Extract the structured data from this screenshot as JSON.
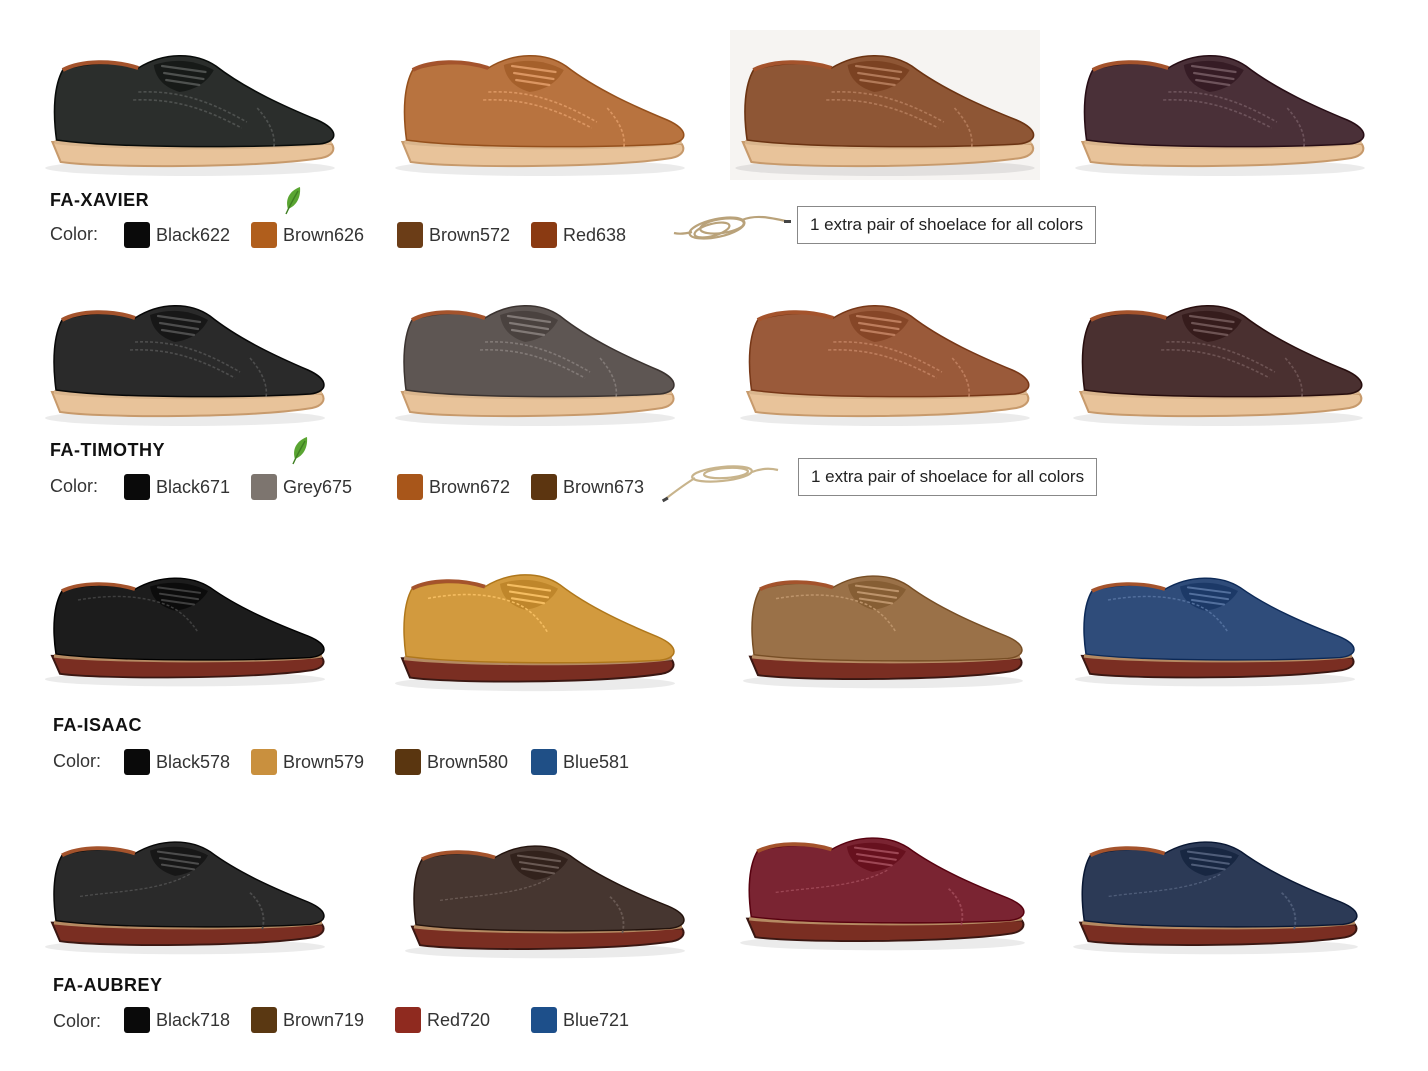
{
  "color_label": "Color:",
  "shoelace_note": "1 extra pair of shoelace for all colors",
  "products": [
    {
      "name": "FA-XAVIER",
      "eco_icon": "leaf-icon",
      "style": "wingtip",
      "colors": [
        {
          "name": "Black622",
          "hex": "#0a0a0a",
          "upper": "#2b2e2c"
        },
        {
          "name": "Brown626",
          "hex": "#b05e1c",
          "upper": "#b8733f"
        },
        {
          "name": "Brown572",
          "hex": "#6b3d17",
          "upper": "#8e5635"
        },
        {
          "name": "Red638",
          "hex": "#8a3a12",
          "upper": "#4a3038"
        }
      ]
    },
    {
      "name": "FA-TIMOTHY",
      "eco_icon": "leaf-icon",
      "style": "wingtip",
      "colors": [
        {
          "name": "Black671",
          "hex": "#0a0a0a",
          "upper": "#2a2a2a"
        },
        {
          "name": "Grey675",
          "hex": "#7d756f",
          "upper": "#5e5653"
        },
        {
          "name": "Brown672",
          "hex": "#a8561a",
          "upper": "#9a5a3a"
        },
        {
          "name": "Brown673",
          "hex": "#5c3510",
          "upper": "#4a3030"
        }
      ]
    },
    {
      "name": "FA-ISAAC",
      "style": "derby",
      "colors": [
        {
          "name": "Black578",
          "hex": "#0a0a0a",
          "upper": "#1c1c1c"
        },
        {
          "name": "Brown579",
          "hex": "#c9903e",
          "upper": "#d29a3e"
        },
        {
          "name": "Brown580",
          "hex": "#5a3610",
          "upper": "#9a7148"
        },
        {
          "name": "Blue581",
          "hex": "#1f4f86",
          "upper": "#2f4c7a"
        }
      ]
    },
    {
      "name": "FA-AUBREY",
      "style": "captoe",
      "colors": [
        {
          "name": "Black718",
          "hex": "#0a0a0a",
          "upper": "#2a2a2a"
        },
        {
          "name": "Brown719",
          "hex": "#5a3812",
          "upper": "#463630"
        },
        {
          "name": "Red720",
          "hex": "#8f2a1f",
          "upper": "#7a2432"
        },
        {
          "name": "Blue721",
          "hex": "#1d4f8a",
          "upper": "#2c3a56"
        }
      ]
    }
  ]
}
